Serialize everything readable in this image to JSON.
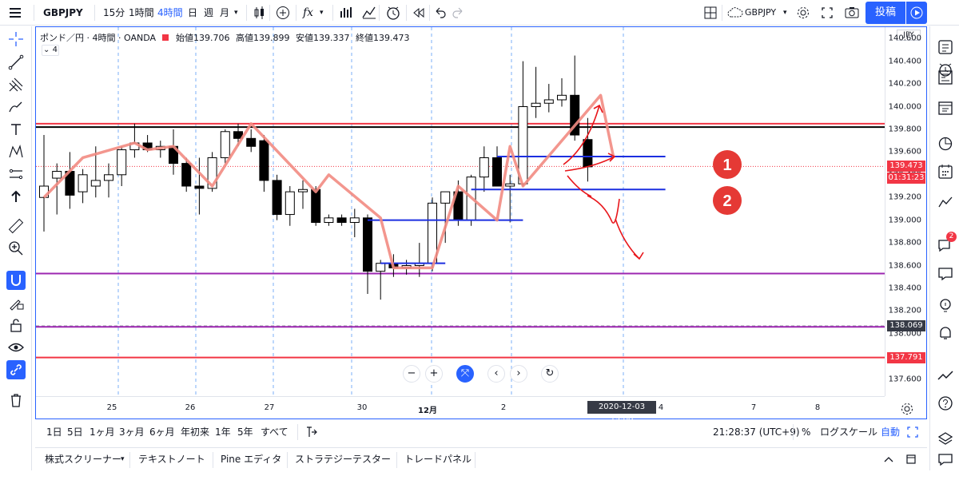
{
  "topbar": {
    "symbol": "GBPJPY",
    "intervals": [
      "15分",
      "1時間",
      "4時間",
      "日",
      "週",
      "月"
    ],
    "active_interval": "4時間",
    "fx_label": "fx",
    "right_symbol": "GBPJPY",
    "publish_label": "投稿"
  },
  "legend": {
    "title": "ポンド／円 · 4時間 · OANDA",
    "open_label": "始値",
    "open": "139.706",
    "high_label": "高値",
    "high": "139.899",
    "low_label": "安値",
    "low": "139.337",
    "close_label": "終値",
    "close": "139.473",
    "collapse_count": "4"
  },
  "price_axis": {
    "currency": "JPY",
    "ticks": [
      "140.600",
      "140.400",
      "140.200",
      "140.000",
      "139.800",
      "139.600",
      "139.400",
      "139.200",
      "139.000",
      "138.800",
      "138.600",
      "138.400",
      "138.200",
      "138.000",
      "137.800",
      "137.600"
    ],
    "last_price": "139.473",
    "countdown": "01:31:23",
    "crosshair_price": "138.069",
    "red_line_price": "137.791",
    "colors": {
      "last_price": "#f23645",
      "red_line": "#f23645",
      "crosshair": "#363a45"
    }
  },
  "time_axis": {
    "labels": [
      "25",
      "26",
      "27",
      "30",
      "12月",
      "2",
      "3",
      "4",
      "7",
      "8"
    ],
    "crosshair_time": "2020-12-03　15:00"
  },
  "annotations": {
    "marker1": "1",
    "marker2": "2"
  },
  "bottombar": {
    "ranges": [
      "1日",
      "5日",
      "1ヶ月",
      "3ヶ月",
      "6ヶ月",
      "年初来",
      "1年",
      "5年",
      "すべて"
    ],
    "clock": "21:28:37 (UTC+9)",
    "percent": "%",
    "log_scale": "ログスケール",
    "auto": "自動"
  },
  "panels": [
    "株式スクリーナー",
    "テキストノート",
    "Pine エディタ",
    "ストラテジーテスター",
    "トレードパネル"
  ],
  "sidebar": {
    "notification_count": "2"
  },
  "chart_data": {
    "type": "candlestick",
    "symbol": "GBPJPY",
    "interval": "4時間",
    "y_range": [
      137.45,
      140.7
    ],
    "candles": [
      {
        "t": 0,
        "o": 139.2,
        "h": 139.75,
        "l": 138.9,
        "c": 139.3
      },
      {
        "t": 1,
        "o": 139.37,
        "h": 139.5,
        "l": 139.05,
        "c": 139.43
      },
      {
        "t": 2,
        "o": 139.43,
        "h": 139.6,
        "l": 139.1,
        "c": 139.22
      },
      {
        "t": 3,
        "o": 139.25,
        "h": 139.45,
        "l": 139.15,
        "c": 139.4
      },
      {
        "t": 4,
        "o": 139.3,
        "h": 139.65,
        "l": 139.2,
        "c": 139.35
      },
      {
        "t": 5,
        "o": 139.35,
        "h": 139.5,
        "l": 139.2,
        "c": 139.4
      },
      {
        "t": 6,
        "o": 139.4,
        "h": 139.65,
        "l": 139.3,
        "c": 139.62
      },
      {
        "t": 7,
        "o": 139.62,
        "h": 139.85,
        "l": 139.55,
        "c": 139.68
      },
      {
        "t": 8,
        "o": 139.68,
        "h": 139.75,
        "l": 139.6,
        "c": 139.62
      },
      {
        "t": 9,
        "o": 139.62,
        "h": 139.7,
        "l": 139.55,
        "c": 139.65
      },
      {
        "t": 10,
        "o": 139.65,
        "h": 139.8,
        "l": 139.4,
        "c": 139.5
      },
      {
        "t": 11,
        "o": 139.5,
        "h": 139.55,
        "l": 139.25,
        "c": 139.3
      },
      {
        "t": 12,
        "o": 139.3,
        "h": 139.55,
        "l": 139.05,
        "c": 139.28
      },
      {
        "t": 13,
        "o": 139.28,
        "h": 139.6,
        "l": 139.25,
        "c": 139.55
      },
      {
        "t": 14,
        "o": 139.55,
        "h": 139.8,
        "l": 139.5,
        "c": 139.78
      },
      {
        "t": 15,
        "o": 139.78,
        "h": 139.85,
        "l": 139.65,
        "c": 139.72
      },
      {
        "t": 16,
        "o": 139.72,
        "h": 139.8,
        "l": 139.6,
        "c": 139.65
      },
      {
        "t": 17,
        "o": 139.7,
        "h": 139.75,
        "l": 139.25,
        "c": 139.35
      },
      {
        "t": 18,
        "o": 139.35,
        "h": 139.4,
        "l": 139.0,
        "c": 139.05
      },
      {
        "t": 19,
        "o": 139.05,
        "h": 139.3,
        "l": 138.95,
        "c": 139.25
      },
      {
        "t": 20,
        "o": 139.25,
        "h": 139.35,
        "l": 139.1,
        "c": 139.27
      },
      {
        "t": 21,
        "o": 139.27,
        "h": 139.3,
        "l": 138.95,
        "c": 138.98
      },
      {
        "t": 22,
        "o": 138.98,
        "h": 139.05,
        "l": 138.95,
        "c": 139.02
      },
      {
        "t": 23,
        "o": 139.02,
        "h": 139.05,
        "l": 138.95,
        "c": 138.98
      },
      {
        "t": 24,
        "o": 138.98,
        "h": 139.1,
        "l": 138.85,
        "c": 139.02
      },
      {
        "t": 25,
        "o": 139.02,
        "h": 139.05,
        "l": 138.35,
        "c": 138.55
      },
      {
        "t": 26,
        "o": 138.55,
        "h": 138.65,
        "l": 138.3,
        "c": 138.62
      },
      {
        "t": 27,
        "o": 138.62,
        "h": 138.7,
        "l": 138.5,
        "c": 138.58
      },
      {
        "t": 28,
        "o": 138.58,
        "h": 138.65,
        "l": 138.52,
        "c": 138.6
      },
      {
        "t": 29,
        "o": 138.6,
        "h": 138.8,
        "l": 138.5,
        "c": 138.62
      },
      {
        "t": 30,
        "o": 138.62,
        "h": 139.2,
        "l": 138.55,
        "c": 139.15
      },
      {
        "t": 31,
        "o": 139.15,
        "h": 139.25,
        "l": 138.8,
        "c": 139.25
      },
      {
        "t": 32,
        "o": 139.25,
        "h": 139.35,
        "l": 138.95,
        "c": 139.0
      },
      {
        "t": 33,
        "o": 139.0,
        "h": 139.4,
        "l": 138.95,
        "c": 139.38
      },
      {
        "t": 34,
        "o": 139.38,
        "h": 139.65,
        "l": 139.25,
        "c": 139.55
      },
      {
        "t": 35,
        "o": 139.55,
        "h": 139.65,
        "l": 139.3,
        "c": 139.3
      },
      {
        "t": 36,
        "o": 139.3,
        "h": 139.4,
        "l": 138.98,
        "c": 139.32
      },
      {
        "t": 37,
        "o": 139.32,
        "h": 140.4,
        "l": 139.3,
        "c": 140.0
      },
      {
        "t": 38,
        "o": 140.0,
        "h": 140.35,
        "l": 139.9,
        "c": 140.03
      },
      {
        "t": 39,
        "o": 140.03,
        "h": 140.2,
        "l": 139.95,
        "c": 140.06
      },
      {
        "t": 40,
        "o": 140.06,
        "h": 140.25,
        "l": 140.0,
        "c": 140.1
      },
      {
        "t": 41,
        "o": 140.1,
        "h": 140.45,
        "l": 139.7,
        "c": 139.75
      },
      {
        "t": 42,
        "o": 139.71,
        "h": 139.9,
        "l": 139.34,
        "c": 139.47
      }
    ],
    "zigzag": [
      [
        0,
        139.2
      ],
      [
        3,
        139.55
      ],
      [
        7,
        139.68
      ],
      [
        8,
        139.62
      ],
      [
        10,
        139.65
      ],
      [
        13,
        139.3
      ],
      [
        16,
        139.85
      ],
      [
        21,
        139.25
      ],
      [
        22,
        139.4
      ],
      [
        26,
        139.02
      ],
      [
        27,
        138.58
      ],
      [
        30,
        138.58
      ],
      [
        32,
        139.3
      ],
      [
        35,
        139.0
      ],
      [
        36,
        139.65
      ],
      [
        37,
        139.3
      ],
      [
        43,
        140.1
      ],
      [
        44,
        139.55
      ]
    ],
    "hlines": [
      {
        "price": 139.85,
        "color": "#f23645"
      },
      {
        "price": 139.82,
        "color": "#000000"
      },
      {
        "price": 138.53,
        "color": "#9c27b0"
      },
      {
        "price": 138.06,
        "color": "#9c27b0"
      },
      {
        "price": 137.79,
        "color": "#f23645"
      }
    ],
    "blue_segments": [
      {
        "price": 139.56,
        "from": 35,
        "to": 48
      },
      {
        "price": 139.27,
        "from": 33,
        "to": 48
      },
      {
        "price": 139.0,
        "from": 25,
        "to": 37
      },
      {
        "price": 138.62,
        "from": 26,
        "to": 31
      }
    ]
  }
}
